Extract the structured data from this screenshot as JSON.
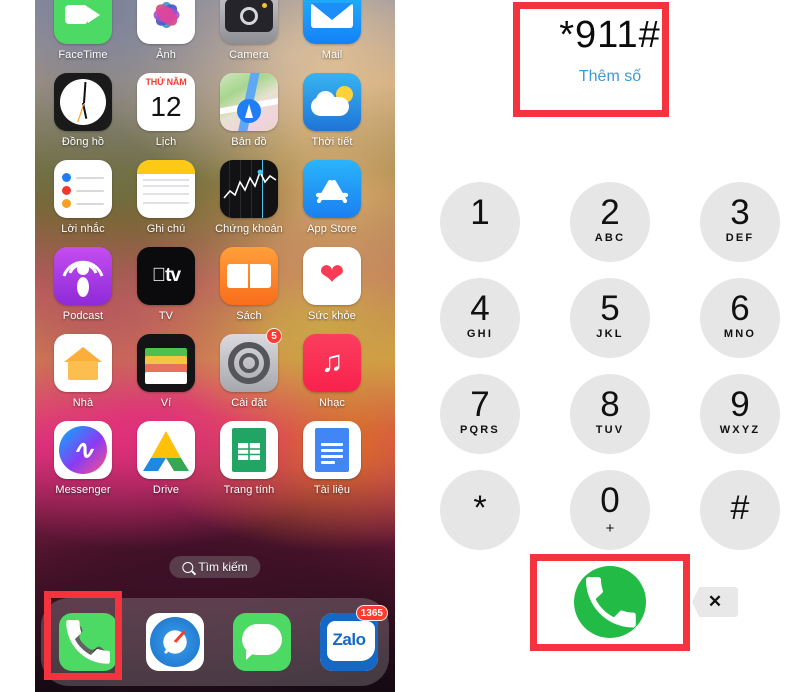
{
  "home_screen": {
    "rows": [
      [
        {
          "label": "FaceTime",
          "icon": "facetime-icon"
        },
        {
          "label": "Ảnh",
          "icon": "photos-icon"
        },
        {
          "label": "Camera",
          "icon": "camera-icon"
        },
        {
          "label": "Mail",
          "icon": "mail-icon"
        }
      ],
      [
        {
          "label": "Đồng hồ",
          "icon": "clock-icon"
        },
        {
          "label": "Lịch",
          "icon": "calendar-icon",
          "day_name": "THỨ NĂM",
          "day_number": "12"
        },
        {
          "label": "Bản đồ",
          "icon": "maps-icon"
        },
        {
          "label": "Thời tiết",
          "icon": "weather-icon"
        }
      ],
      [
        {
          "label": "Lời nhắc",
          "icon": "reminders-icon"
        },
        {
          "label": "Ghi chú",
          "icon": "notes-icon"
        },
        {
          "label": "Chứng khoán",
          "icon": "stocks-icon"
        },
        {
          "label": "App Store",
          "icon": "app-store-icon"
        }
      ],
      [
        {
          "label": "Podcast",
          "icon": "podcasts-icon"
        },
        {
          "label": "TV",
          "icon": "apple-tv-icon",
          "glyph": "tv"
        },
        {
          "label": "Sách",
          "icon": "books-icon"
        },
        {
          "label": "Sức khỏe",
          "icon": "health-icon"
        }
      ],
      [
        {
          "label": "Nhà",
          "icon": "home-app-icon"
        },
        {
          "label": "Ví",
          "icon": "wallet-icon"
        },
        {
          "label": "Cài đặt",
          "icon": "settings-icon",
          "badge": "5"
        },
        {
          "label": "Nhạc",
          "icon": "music-icon"
        }
      ],
      [
        {
          "label": "Messenger",
          "icon": "messenger-icon"
        },
        {
          "label": "Drive",
          "icon": "google-drive-icon"
        },
        {
          "label": "Trang tính",
          "icon": "google-sheets-icon"
        },
        {
          "label": "Tài liệu",
          "icon": "google-docs-icon"
        }
      ]
    ],
    "search": {
      "label": "Tìm kiếm",
      "icon": "search-icon"
    },
    "dock": [
      {
        "label": "Phone",
        "icon": "phone-icon",
        "highlighted": true
      },
      {
        "label": "Safari",
        "icon": "safari-icon"
      },
      {
        "label": "Messages",
        "icon": "messages-icon"
      },
      {
        "label": "Zalo",
        "icon": "zalo-icon",
        "badge": "1365",
        "zalo_text": "Zalo"
      }
    ]
  },
  "dialer": {
    "number": "*911#",
    "add_number_label": "Thêm số",
    "keys": [
      {
        "digit": "1",
        "letters": ""
      },
      {
        "digit": "2",
        "letters": "ABC"
      },
      {
        "digit": "3",
        "letters": "DEF"
      },
      {
        "digit": "4",
        "letters": "GHI"
      },
      {
        "digit": "5",
        "letters": "JKL"
      },
      {
        "digit": "6",
        "letters": "MNO"
      },
      {
        "digit": "7",
        "letters": "PQRS"
      },
      {
        "digit": "8",
        "letters": "TUV"
      },
      {
        "digit": "9",
        "letters": "WXYZ"
      },
      {
        "digit": "*",
        "letters": ""
      },
      {
        "digit": "0",
        "letters": "+"
      },
      {
        "digit": "#",
        "letters": ""
      }
    ],
    "call_button": {
      "icon": "phone-icon",
      "color": "#22bb45"
    },
    "delete_key": {
      "icon": "backspace-icon",
      "glyph": "✕"
    }
  },
  "annotations": {
    "highlight_color": "#f5333f",
    "boxes": [
      "number-display-highlight",
      "dock-phone-highlight",
      "call-button-highlight"
    ]
  }
}
